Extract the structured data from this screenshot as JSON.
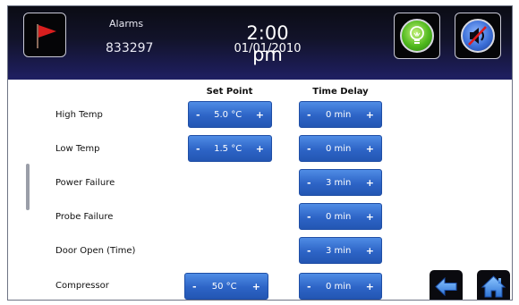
{
  "header": {
    "section_label": "Alarms",
    "unit_id": "833297",
    "time": "2:00 pm",
    "date": "01/01/2010"
  },
  "icons": {
    "alarm_flag": "red-flag-icon",
    "light": "lightbulb-icon",
    "mute": "speaker-muted-icon",
    "back": "back-arrow-icon",
    "home": "home-icon"
  },
  "columns": {
    "set_point": "Set Point",
    "time_delay": "Time Delay"
  },
  "controls": {
    "minus": "-",
    "plus": "+"
  },
  "rows": [
    {
      "label": "High Temp",
      "set_point": "5.0 °C",
      "time_delay": "0 min"
    },
    {
      "label": "Low Temp",
      "set_point": "1.5 °C",
      "time_delay": "0 min"
    },
    {
      "label": "Power Failure",
      "set_point": null,
      "time_delay": "3 min"
    },
    {
      "label": "Probe Failure",
      "set_point": null,
      "time_delay": "0 min"
    },
    {
      "label": "Door Open (Time)",
      "set_point": null,
      "time_delay": "3 min"
    },
    {
      "label": "Compressor",
      "set_point": "50 °C",
      "time_delay": "0 min"
    }
  ],
  "colors": {
    "header_top": "#0b0c14",
    "header_bottom": "#1f1f63",
    "control_blue": "#2d64c6",
    "flag_red": "#d81e1e",
    "bulb_green": "#4fb91d",
    "mute_blue": "#3c6fd8"
  }
}
